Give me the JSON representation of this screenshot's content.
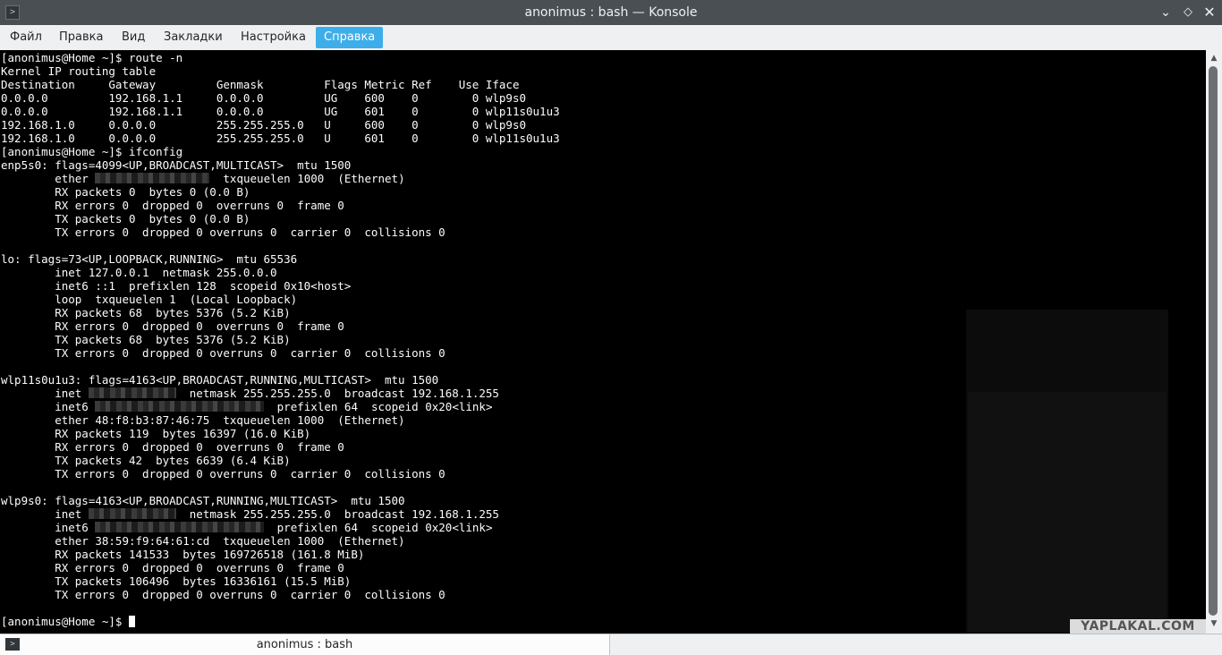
{
  "window": {
    "title": "anonimus : bash — Konsole"
  },
  "menu": {
    "items": [
      "Файл",
      "Правка",
      "Вид",
      "Закладки",
      "Настройка",
      "Справка"
    ],
    "active_index": 5
  },
  "terminal": {
    "lines": [
      [
        {
          "t": "[anonimus@Home ~]$ route -n"
        }
      ],
      [
        {
          "t": "Kernel IP routing table"
        }
      ],
      [
        {
          "t": "Destination     Gateway         Genmask         Flags Metric Ref    Use Iface"
        }
      ],
      [
        {
          "t": "0.0.0.0         192.168.1.1     0.0.0.0         UG    600    0        0 wlp9s0"
        }
      ],
      [
        {
          "t": "0.0.0.0         192.168.1.1     0.0.0.0         UG    601    0        0 wlp11s0u1u3"
        }
      ],
      [
        {
          "t": "192.168.1.0     0.0.0.0         255.255.255.0   U     600    0        0 wlp9s0"
        }
      ],
      [
        {
          "t": "192.168.1.0     0.0.0.0         255.255.255.0   U     601    0        0 wlp11s0u1u3"
        }
      ],
      [
        {
          "t": "[anonimus@Home ~]$ ifconfig"
        }
      ],
      [
        {
          "t": "enp5s0: flags=4099<UP,BROADCAST,MULTICAST>  mtu 1500"
        }
      ],
      [
        {
          "t": "        ether "
        },
        {
          "r": 17
        },
        {
          "t": "  txqueuelen 1000  (Ethernet)"
        }
      ],
      [
        {
          "t": "        RX packets 0  bytes 0 (0.0 B)"
        }
      ],
      [
        {
          "t": "        RX errors 0  dropped 0  overruns 0  frame 0"
        }
      ],
      [
        {
          "t": "        TX packets 0  bytes 0 (0.0 B)"
        }
      ],
      [
        {
          "t": "        TX errors 0  dropped 0 overruns 0  carrier 0  collisions 0"
        }
      ],
      [
        {
          "t": ""
        }
      ],
      [
        {
          "t": "lo: flags=73<UP,LOOPBACK,RUNNING>  mtu 65536"
        }
      ],
      [
        {
          "t": "        inet 127.0.0.1  netmask 255.0.0.0"
        }
      ],
      [
        {
          "t": "        inet6 ::1  prefixlen 128  scopeid 0x10<host>"
        }
      ],
      [
        {
          "t": "        loop  txqueuelen 1  (Local Loopback)"
        }
      ],
      [
        {
          "t": "        RX packets 68  bytes 5376 (5.2 KiB)"
        }
      ],
      [
        {
          "t": "        RX errors 0  dropped 0  overruns 0  frame 0"
        }
      ],
      [
        {
          "t": "        TX packets 68  bytes 5376 (5.2 KiB)"
        }
      ],
      [
        {
          "t": "        TX errors 0  dropped 0 overruns 0  carrier 0  collisions 0"
        }
      ],
      [
        {
          "t": ""
        }
      ],
      [
        {
          "t": "wlp11s0u1u3: flags=4163<UP,BROADCAST,RUNNING,MULTICAST>  mtu 1500"
        }
      ],
      [
        {
          "t": "        inet "
        },
        {
          "r": 13
        },
        {
          "t": "  netmask 255.255.255.0  broadcast 192.168.1.255"
        }
      ],
      [
        {
          "t": "        inet6 "
        },
        {
          "r": 25
        },
        {
          "t": "  prefixlen 64  scopeid 0x20<link>"
        }
      ],
      [
        {
          "t": "        ether 48:f8:b3:87:46:75  txqueuelen 1000  (Ethernet)"
        }
      ],
      [
        {
          "t": "        RX packets 119  bytes 16397 (16.0 KiB)"
        }
      ],
      [
        {
          "t": "        RX errors 0  dropped 0  overruns 0  frame 0"
        }
      ],
      [
        {
          "t": "        TX packets 42  bytes 6639 (6.4 KiB)"
        }
      ],
      [
        {
          "t": "        TX errors 0  dropped 0 overruns 0  carrier 0  collisions 0"
        }
      ],
      [
        {
          "t": ""
        }
      ],
      [
        {
          "t": "wlp9s0: flags=4163<UP,BROADCAST,RUNNING,MULTICAST>  mtu 1500"
        }
      ],
      [
        {
          "t": "        inet "
        },
        {
          "r": 13
        },
        {
          "t": "  netmask 255.255.255.0  broadcast 192.168.1.255"
        }
      ],
      [
        {
          "t": "        inet6 "
        },
        {
          "r": 25
        },
        {
          "t": "  prefixlen 64  scopeid 0x20<link>"
        }
      ],
      [
        {
          "t": "        ether 38:59:f9:64:61:cd  txqueuelen 1000  (Ethernet)"
        }
      ],
      [
        {
          "t": "        RX packets 141533  bytes 169726518 (161.8 MiB)"
        }
      ],
      [
        {
          "t": "        RX errors 0  dropped 0  overruns 0  frame 0"
        }
      ],
      [
        {
          "t": "        TX packets 106496  bytes 16336161 (15.5 MiB)"
        }
      ],
      [
        {
          "t": "        TX errors 0  dropped 0 overruns 0  carrier 0  collisions 0"
        }
      ],
      [
        {
          "t": ""
        }
      ],
      [
        {
          "t": "[anonimus@Home ~]$ "
        },
        {
          "cursor": true
        }
      ]
    ],
    "watermark": "YAPLAKAL.COM"
  },
  "tabs": [
    {
      "label": "anonimus : bash"
    }
  ],
  "colors": {
    "titlebar": "#4a4f54",
    "menubar": "#eff0f1",
    "accent": "#3daee9",
    "terminal_bg": "#000000",
    "terminal_fg": "#fcfcfc"
  },
  "icons": {
    "app": "terminal-icon",
    "minimize": "chevron-down-icon",
    "maximize": "diamond-icon",
    "close": "close-icon"
  }
}
